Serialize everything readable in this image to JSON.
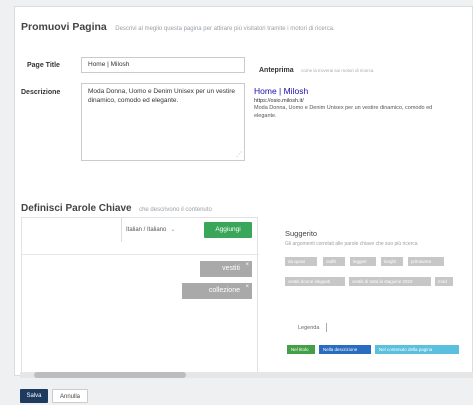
{
  "header": {
    "title": "Promuovi Pagina",
    "subtitle": "Descrivi al meglio questa pagina per attirare più visitatori tramite i motori di ricerca."
  },
  "form": {
    "page_title_label": "Page Title",
    "page_title_value": "Home | Milosh",
    "description_label": "Descrizione",
    "description_value": "Moda Donna, Uomo e Denim Unisex per un vestire dinamico, comodo ed elegante."
  },
  "preview": {
    "label": "Anteprima",
    "sublabel": "come la troverai sui motori di ricerca",
    "title": "Home | Milosh",
    "url": "https://osio.milosh.it/",
    "description": "Moda Donna, Uomo e Denim Unisex per un vestire dinamico, comodo ed elegante."
  },
  "keywords": {
    "title": "Definisci Parole Chiave",
    "subtitle": "che descrivono il contenuto",
    "input_value": "",
    "language": "Italian / Italiano",
    "add_label": "Aggiungi",
    "tags": [
      "vestiti",
      "collezione"
    ],
    "remove_icon": "close-icon"
  },
  "suggestions": {
    "title": "Suggerito",
    "subtitle": "Gli argomenti correlati alle parole chiave che suo più ricerca",
    "tags": [
      "da quasi",
      "outfit",
      "leggeri",
      "lunghi",
      "primavera",
      "vestiti donne eleganti",
      "vestiti di tutta la stagione 2023",
      "mod"
    ]
  },
  "legend": {
    "label": "Legenda",
    "items": [
      {
        "label": "Nel titolo",
        "color": "#43a047"
      },
      {
        "label": "Nella descrizione",
        "color": "#2a6cc0"
      },
      {
        "label": "Nel contenuto della pagina",
        "color": "#5bc0de"
      }
    ]
  },
  "actions": {
    "save_label": "Salva",
    "cancel_label": "Annulla"
  },
  "colors": {
    "accent_green": "#3aa65a",
    "primary_dark": "#1e3a5f",
    "link_blue": "#1a0dab"
  }
}
